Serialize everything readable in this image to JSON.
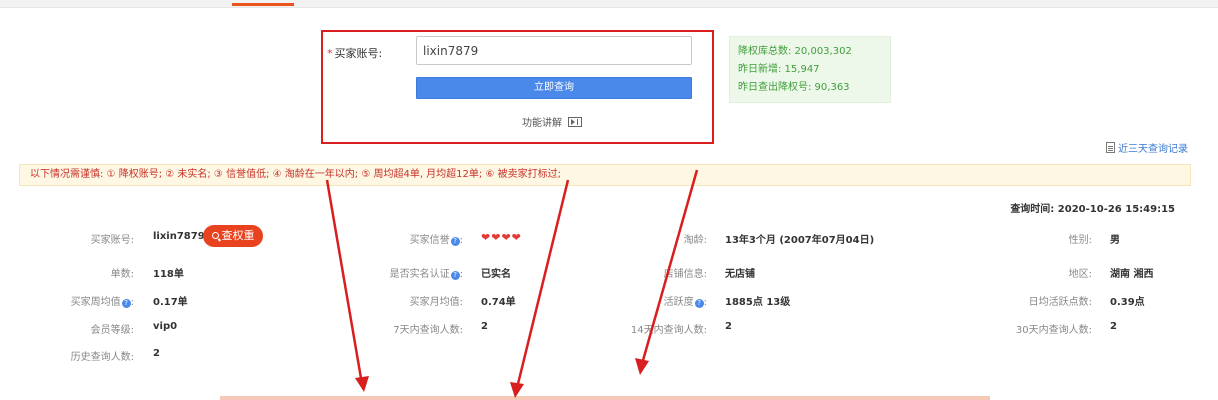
{
  "query_form": {
    "account_label": "买家账号:",
    "account_value": "lixin7879",
    "query_button": "立即查询",
    "explain_link": "功能讲解"
  },
  "stats": {
    "total": "降权库总数: 20,003,302",
    "yesterday_new": "昨日新增: 15,947",
    "yesterday_checked": "昨日查出降权号: 90,363"
  },
  "history_link": "近三天查询记录",
  "notice": "以下情况需谨慎: ① 降权账号; ② 未实名; ③ 信誉值低; ④ 淘龄在一年以内; ⑤ 周均超4单, 月均超12单; ⑥ 被卖家打标过;",
  "query_time": "查询时间: 2020-10-26 15:49:15",
  "info": {
    "buyer_account_label": "买家账号:",
    "buyer_account_value": "lixin7879",
    "check_weight_button": "查权重",
    "reputation_label": "买家信誉",
    "taoling_label": "淘龄:",
    "taoling_value": "13年3个月 (2007年07月04日)",
    "gender_label": "性别:",
    "gender_value": "男",
    "orders_label": "单数:",
    "orders_value": "118单",
    "realname_label": "是否实名认证",
    "realname_value": "已实名",
    "shop_label": "店铺信息:",
    "shop_value": "无店铺",
    "region_label": "地区:",
    "region_value": "湖南 湘西",
    "weekly_label": "买家周均值",
    "weekly_value": "0.17单",
    "monthly_label": "买家月均值:",
    "monthly_value": "0.74单",
    "activity_label": "活跃度",
    "activity_value": "1885点 13级",
    "daily_active_label": "日均活跃点数:",
    "daily_active_value": "0.39点",
    "member_label": "会员等级:",
    "member_value": "vip0",
    "q7_label": "7天内查询人数:",
    "q7_value": "2",
    "q14_label": "14天内查询人数:",
    "q14_value": "2",
    "q30_label": "30天内查询人数:",
    "q30_value": "2",
    "history_q_label": "历史查询人数:",
    "history_q_value": "2"
  },
  "colors": {
    "accent": "#4a88ea",
    "annotation_red": "#d81e1e",
    "warning_text": "#c8322a",
    "stats_green": "#3f9e3a"
  }
}
